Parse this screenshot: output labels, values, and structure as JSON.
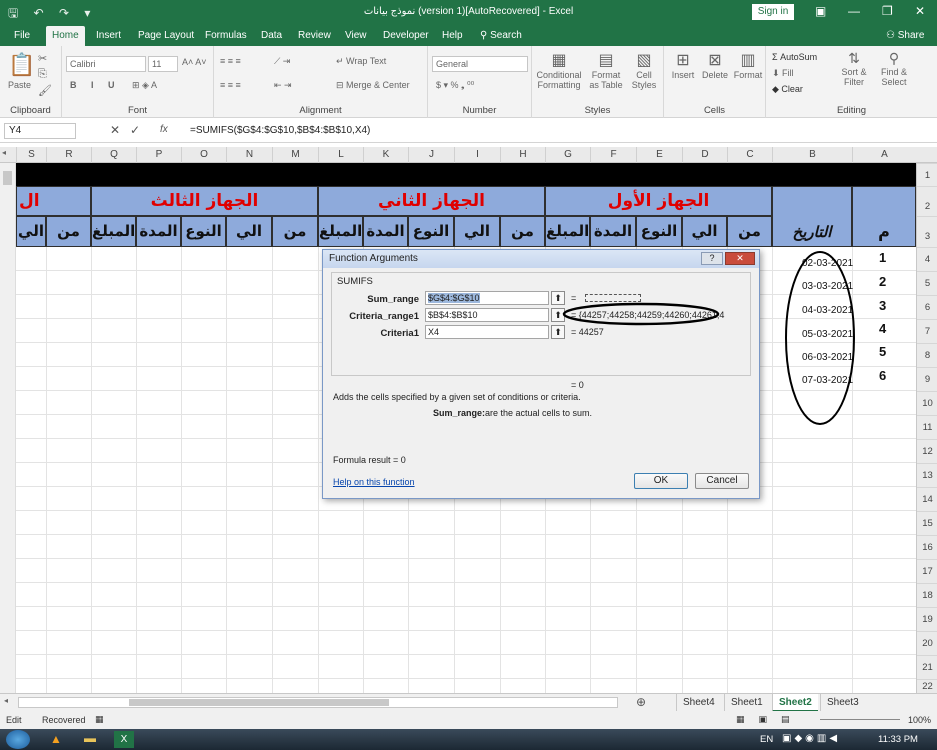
{
  "window": {
    "title": "نموذج بيانات (version 1)[AutoRecovered] - Excel",
    "sign_in": "Sign in",
    "share": "Share"
  },
  "tabs": [
    "File",
    "Home",
    "Insert",
    "Page Layout",
    "Formulas",
    "Data",
    "Review",
    "View",
    "Developer",
    "Help"
  ],
  "tell_me": "Search",
  "ribbon": {
    "clipboard": {
      "label": "Clipboard",
      "paste": "Paste"
    },
    "font": {
      "label": "Font",
      "name": "Calibri",
      "size": "11"
    },
    "alignment": {
      "label": "Alignment",
      "wrap": "Wrap Text",
      "merge": "Merge & Center"
    },
    "number": {
      "label": "Number",
      "format": "General"
    },
    "styles": {
      "label": "Styles",
      "cond": "Conditional Formatting",
      "table": "Format as Table",
      "cell": "Cell Styles"
    },
    "cells": {
      "label": "Cells",
      "insert": "Insert",
      "delete": "Delete",
      "format": "Format"
    },
    "editing": {
      "label": "Editing",
      "autosum": "AutoSum",
      "fill": "Fill",
      "clear": "Clear",
      "sort": "Sort & Filter",
      "find": "Find & Select"
    }
  },
  "formula_bar": {
    "name_box": "Y4",
    "fx": "fx",
    "formula": "=SUMIFS($G$4:$G$10,$B$4:$B$10,X4)"
  },
  "columns": [
    "S",
    "R",
    "Q",
    "P",
    "O",
    "N",
    "M",
    "L",
    "K",
    "J",
    "I",
    "H",
    "G",
    "F",
    "E",
    "D",
    "C",
    "B",
    "A"
  ],
  "rows": [
    "1",
    "2",
    "3",
    "4",
    "5",
    "6",
    "7",
    "8",
    "9",
    "10",
    "11",
    "12",
    "13",
    "14",
    "15",
    "16",
    "17",
    "18",
    "19",
    "20",
    "21",
    "22"
  ],
  "sheet": {
    "device1": "الجهاز الأول",
    "device2": "الجهاز الثاني",
    "device3": "الجهاز الثالث",
    "device3_partial": "ال",
    "sub": {
      "from": "من",
      "to": "الي",
      "type": "النوع",
      "duration": "المدة",
      "amount": "المبلغ"
    },
    "sub_partial": "الي",
    "date_hdr": "التاريخ",
    "m_hdr": "م",
    "dates": [
      "02-03-2021",
      "03-03-2021",
      "04-03-2021",
      "05-03-2021",
      "06-03-2021",
      "07-03-2021"
    ],
    "nums": [
      "1",
      "2",
      "3",
      "4",
      "5",
      "6"
    ]
  },
  "dialog": {
    "title": "Function Arguments",
    "func": "SUMIFS",
    "args": [
      {
        "label": "Sum_range",
        "value": "$G$4:$G$10",
        "result": "= "
      },
      {
        "label": "Criteria_range1",
        "value": "$B$4:$B$10",
        "result": "= {44257;44258;44259;44260;44261;4"
      },
      {
        "label": "Criteria1",
        "value": "X4",
        "result": "= 44257"
      }
    ],
    "total": "= 0",
    "desc": "Adds the cells specified by a given set of conditions or criteria.",
    "arg_name": "Sum_range:",
    "arg_desc": "are the actual cells to sum.",
    "result_label": "Formula result =",
    "result_value": "0",
    "help": "Help on this function",
    "ok": "OK",
    "cancel": "Cancel"
  },
  "sheet_tabs": [
    "Sheet4",
    "Sheet1",
    "Sheet2",
    "Sheet3"
  ],
  "active_sheet": "Sheet2",
  "status": {
    "mode": "Edit",
    "recovered": "Recovered",
    "zoom": "100%"
  },
  "taskbar": {
    "lang": "EN",
    "time": "11:33 PM"
  }
}
